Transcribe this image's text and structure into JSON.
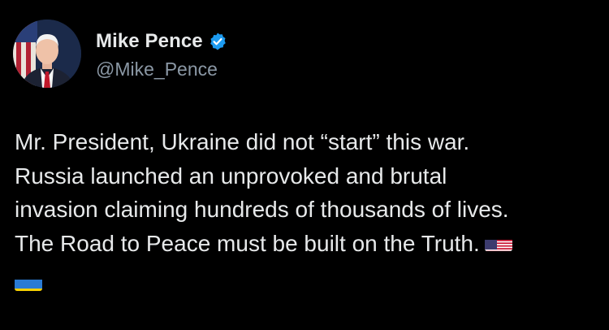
{
  "author": {
    "display_name": "Mike Pence",
    "handle": "@Mike_Pence",
    "verified_icon": "verified-badge-icon",
    "avatar_icon": "profile-photo"
  },
  "tweet": {
    "lines": [
      "Mr. President, Ukraine did not “start” this war.",
      "Russia launched an unprovoked and brutal",
      "invasion claiming hundreds of thousands of lives.",
      "The Road to Peace must be built on the Truth."
    ],
    "emojis": [
      "us-flag-emoji",
      "ukraine-flag-emoji"
    ]
  },
  "colors": {
    "background": "#000000",
    "text": "#e7e9ea",
    "handle": "#8b98a5",
    "verified": "#1d9bf0"
  }
}
